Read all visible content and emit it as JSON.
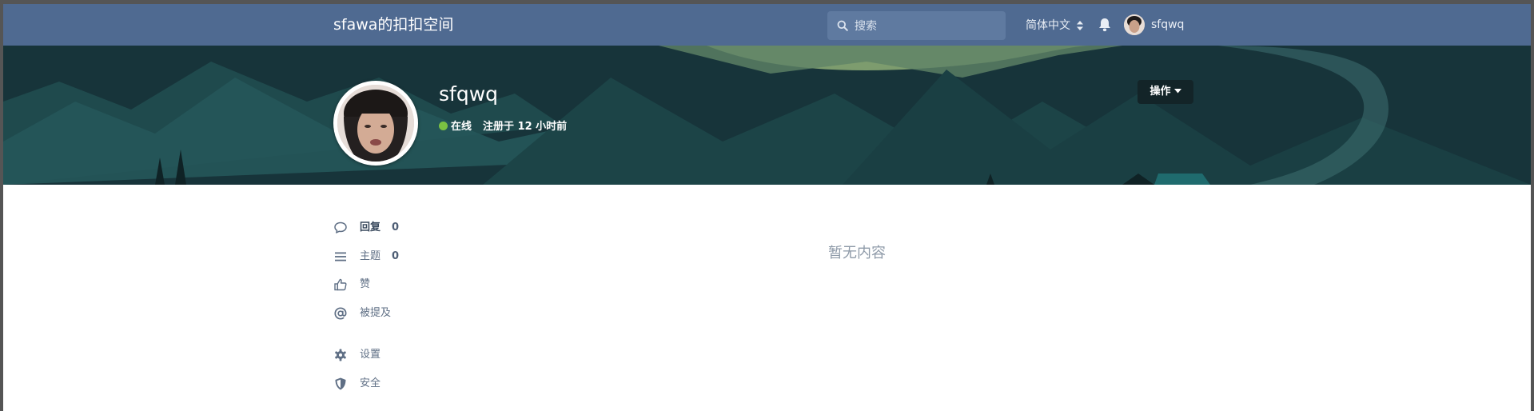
{
  "header": {
    "site_title": "sfawa的扣扣空间",
    "search_placeholder": "搜索",
    "language": "简体中文",
    "username": "sfqwq",
    "bell_icon": "bell-icon"
  },
  "profile": {
    "name": "sfqwq",
    "status": "在线",
    "status_color": "#7bc142",
    "joined": "注册于 12 小时前",
    "actions_label": "操作"
  },
  "sidebar": {
    "items": [
      {
        "label": "回复",
        "count": "0",
        "icon": "comment-icon"
      },
      {
        "label": "主题",
        "count": "0",
        "icon": "list-icon"
      },
      {
        "label": "赞",
        "icon": "thumbs-up-icon"
      },
      {
        "label": "被提及",
        "icon": "at-icon"
      },
      {
        "label": "设置",
        "icon": "gear-icon"
      },
      {
        "label": "安全",
        "icon": "shield-icon"
      }
    ]
  },
  "main": {
    "empty_text": "暂无内容"
  },
  "colors": {
    "header_bg": "#4f6a91",
    "hero_bg": "#17343a",
    "accent_text": "#5f6f85"
  }
}
